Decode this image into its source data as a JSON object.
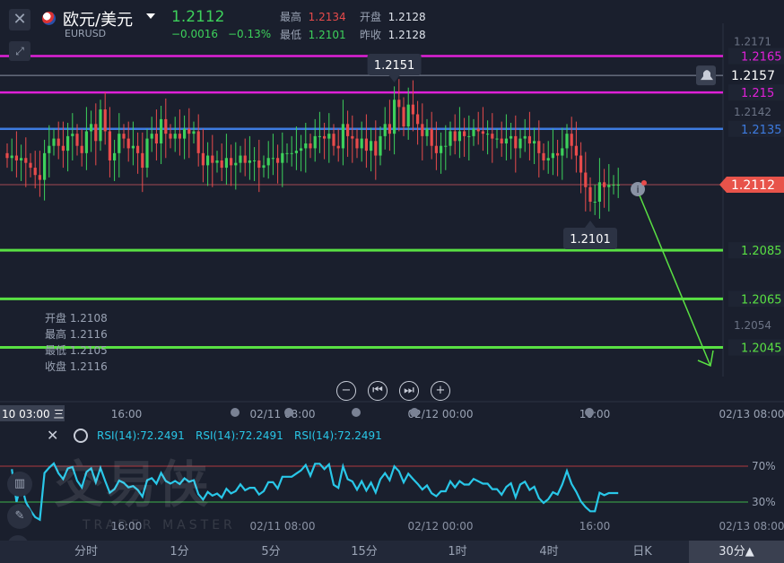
{
  "header": {
    "symbol": "欧元/美元",
    "symbol_code": "EURUSD",
    "last_price": "1.2112",
    "change": "−0.0016",
    "change_pct": "−0.13%",
    "high_label": "最高",
    "high": "1.2134",
    "low_label": "最低",
    "low": "1.2101",
    "open_label": "开盘",
    "open": "1.2128",
    "prev_close_label": "昨收",
    "prev_close": "1.2128"
  },
  "hover_ohlc": {
    "open": "开盘 1.2108",
    "high": "最高 1.2116",
    "low": "最低 1.2105",
    "close": "收盘 1.2116"
  },
  "colors": {
    "background": "#1a1f2d",
    "up": "#3dd15b",
    "down": "#e84b4b",
    "magenta": "#e020d8",
    "blue": "#3d7be0",
    "green_line": "#59e043",
    "rsi": "#29c7e8",
    "last_price_tag": "#e8534a"
  },
  "icons": [
    "close-icon",
    "expand-icon",
    "flag-icon",
    "caret-down-icon",
    "bell-icon",
    "info-icon",
    "zoom-out-icon",
    "step-back-icon",
    "step-forward-icon",
    "zoom-in-icon",
    "settings-icon",
    "indicator-icon",
    "draw-icon",
    "wave-icon"
  ],
  "timeframes": [
    "分时",
    "1分",
    "5分",
    "15分",
    "1时",
    "4时",
    "日K",
    "30分▲"
  ],
  "active_timeframe": "30分▲",
  "time_axis": [
    "16:00",
    "02/11 08:00",
    "02/12 00:00",
    "16:00",
    "02/13 08:00"
  ],
  "crosshair_time": "10 03:00 三",
  "rsi_labels": [
    "RSI(14):72.2491",
    "RSI(14):72.2491",
    "RSI(14):72.2491"
  ],
  "rsi_levels": [
    "70%",
    "30%"
  ],
  "watermark": "交易侠",
  "watermark_sub": "TRADER MASTER",
  "chart_data": {
    "type": "candlestick",
    "timeframe": "30分",
    "y_ticks": [
      1.2171,
      1.2142,
      1.2054
    ],
    "ylim": [
      1.2033,
      1.2177
    ],
    "last_price": 1.2112,
    "last_tag_label": "1.2112",
    "max_label": "1.2151",
    "min_label": "1.2101",
    "bell_label": "1.2157",
    "levels": [
      {
        "value": 1.2165,
        "label": "1.2165",
        "color": "#e020d8"
      },
      {
        "value": 1.215,
        "label": "1.215",
        "color": "#e020d8"
      },
      {
        "value": 1.2135,
        "label": "1.2135",
        "color": "#3d7be0"
      },
      {
        "value": 1.2085,
        "label": "1.2085",
        "color": "#59e043"
      },
      {
        "value": 1.2065,
        "label": "1.2065",
        "color": "#59e043"
      },
      {
        "value": 1.2045,
        "label": "1.2045",
        "color": "#59e043"
      }
    ],
    "bell_level": 1.2157,
    "closes": [
      1.2123,
      1.2124,
      1.2122,
      1.2123,
      1.2121,
      1.2119,
      1.2116,
      1.2114,
      1.2125,
      1.2128,
      1.2131,
      1.2128,
      1.2126,
      1.2132,
      1.2133,
      1.2128,
      1.2125,
      1.2134,
      1.2137,
      1.213,
      1.2143,
      1.2134,
      1.2122,
      1.2125,
      1.2133,
      1.2131,
      1.2127,
      1.2128,
      1.2125,
      1.2119,
      1.2131,
      1.2133,
      1.2129,
      1.2139,
      1.2133,
      1.2131,
      1.2133,
      1.2131,
      1.2135,
      1.2133,
      1.2134,
      1.2125,
      1.212,
      1.2124,
      1.2121,
      1.2122,
      1.2119,
      1.2123,
      1.212,
      1.2121,
      1.2124,
      1.2121,
      1.2122,
      1.2122,
      1.2119,
      1.212,
      1.2123,
      1.2123,
      1.2121,
      1.2125,
      1.2125,
      1.2125,
      1.2126,
      1.2127,
      1.2129,
      1.2127,
      1.2132,
      1.2132,
      1.2131,
      1.2133,
      1.2128,
      1.2127,
      1.2137,
      1.2132,
      1.2131,
      1.2127,
      1.2131,
      1.2126,
      1.213,
      1.2124,
      1.2132,
      1.2137,
      1.2133,
      1.2147,
      1.2144,
      1.2136,
      1.2145,
      1.2141,
      1.2137,
      1.2132,
      1.2135,
      1.2128,
      1.2125,
      1.2128,
      1.2128,
      1.2134,
      1.213,
      1.2134,
      1.2132,
      1.2132,
      1.2135,
      1.2134,
      1.2133,
      1.2133,
      1.2131,
      1.2131,
      1.2129,
      1.2131,
      1.2132,
      1.2127,
      1.2131,
      1.2132,
      1.2129,
      1.213,
      1.2125,
      1.2122,
      1.2123,
      1.2125,
      1.2124,
      1.2127,
      1.2133,
      1.2128,
      1.2124,
      1.2117,
      1.2111,
      1.2105,
      1.2105,
      1.2113,
      1.2111,
      1.2112,
      1.2112,
      1.2112
    ],
    "rsi": {
      "levels": [
        70,
        30
      ],
      "last": 72.2491
    }
  }
}
